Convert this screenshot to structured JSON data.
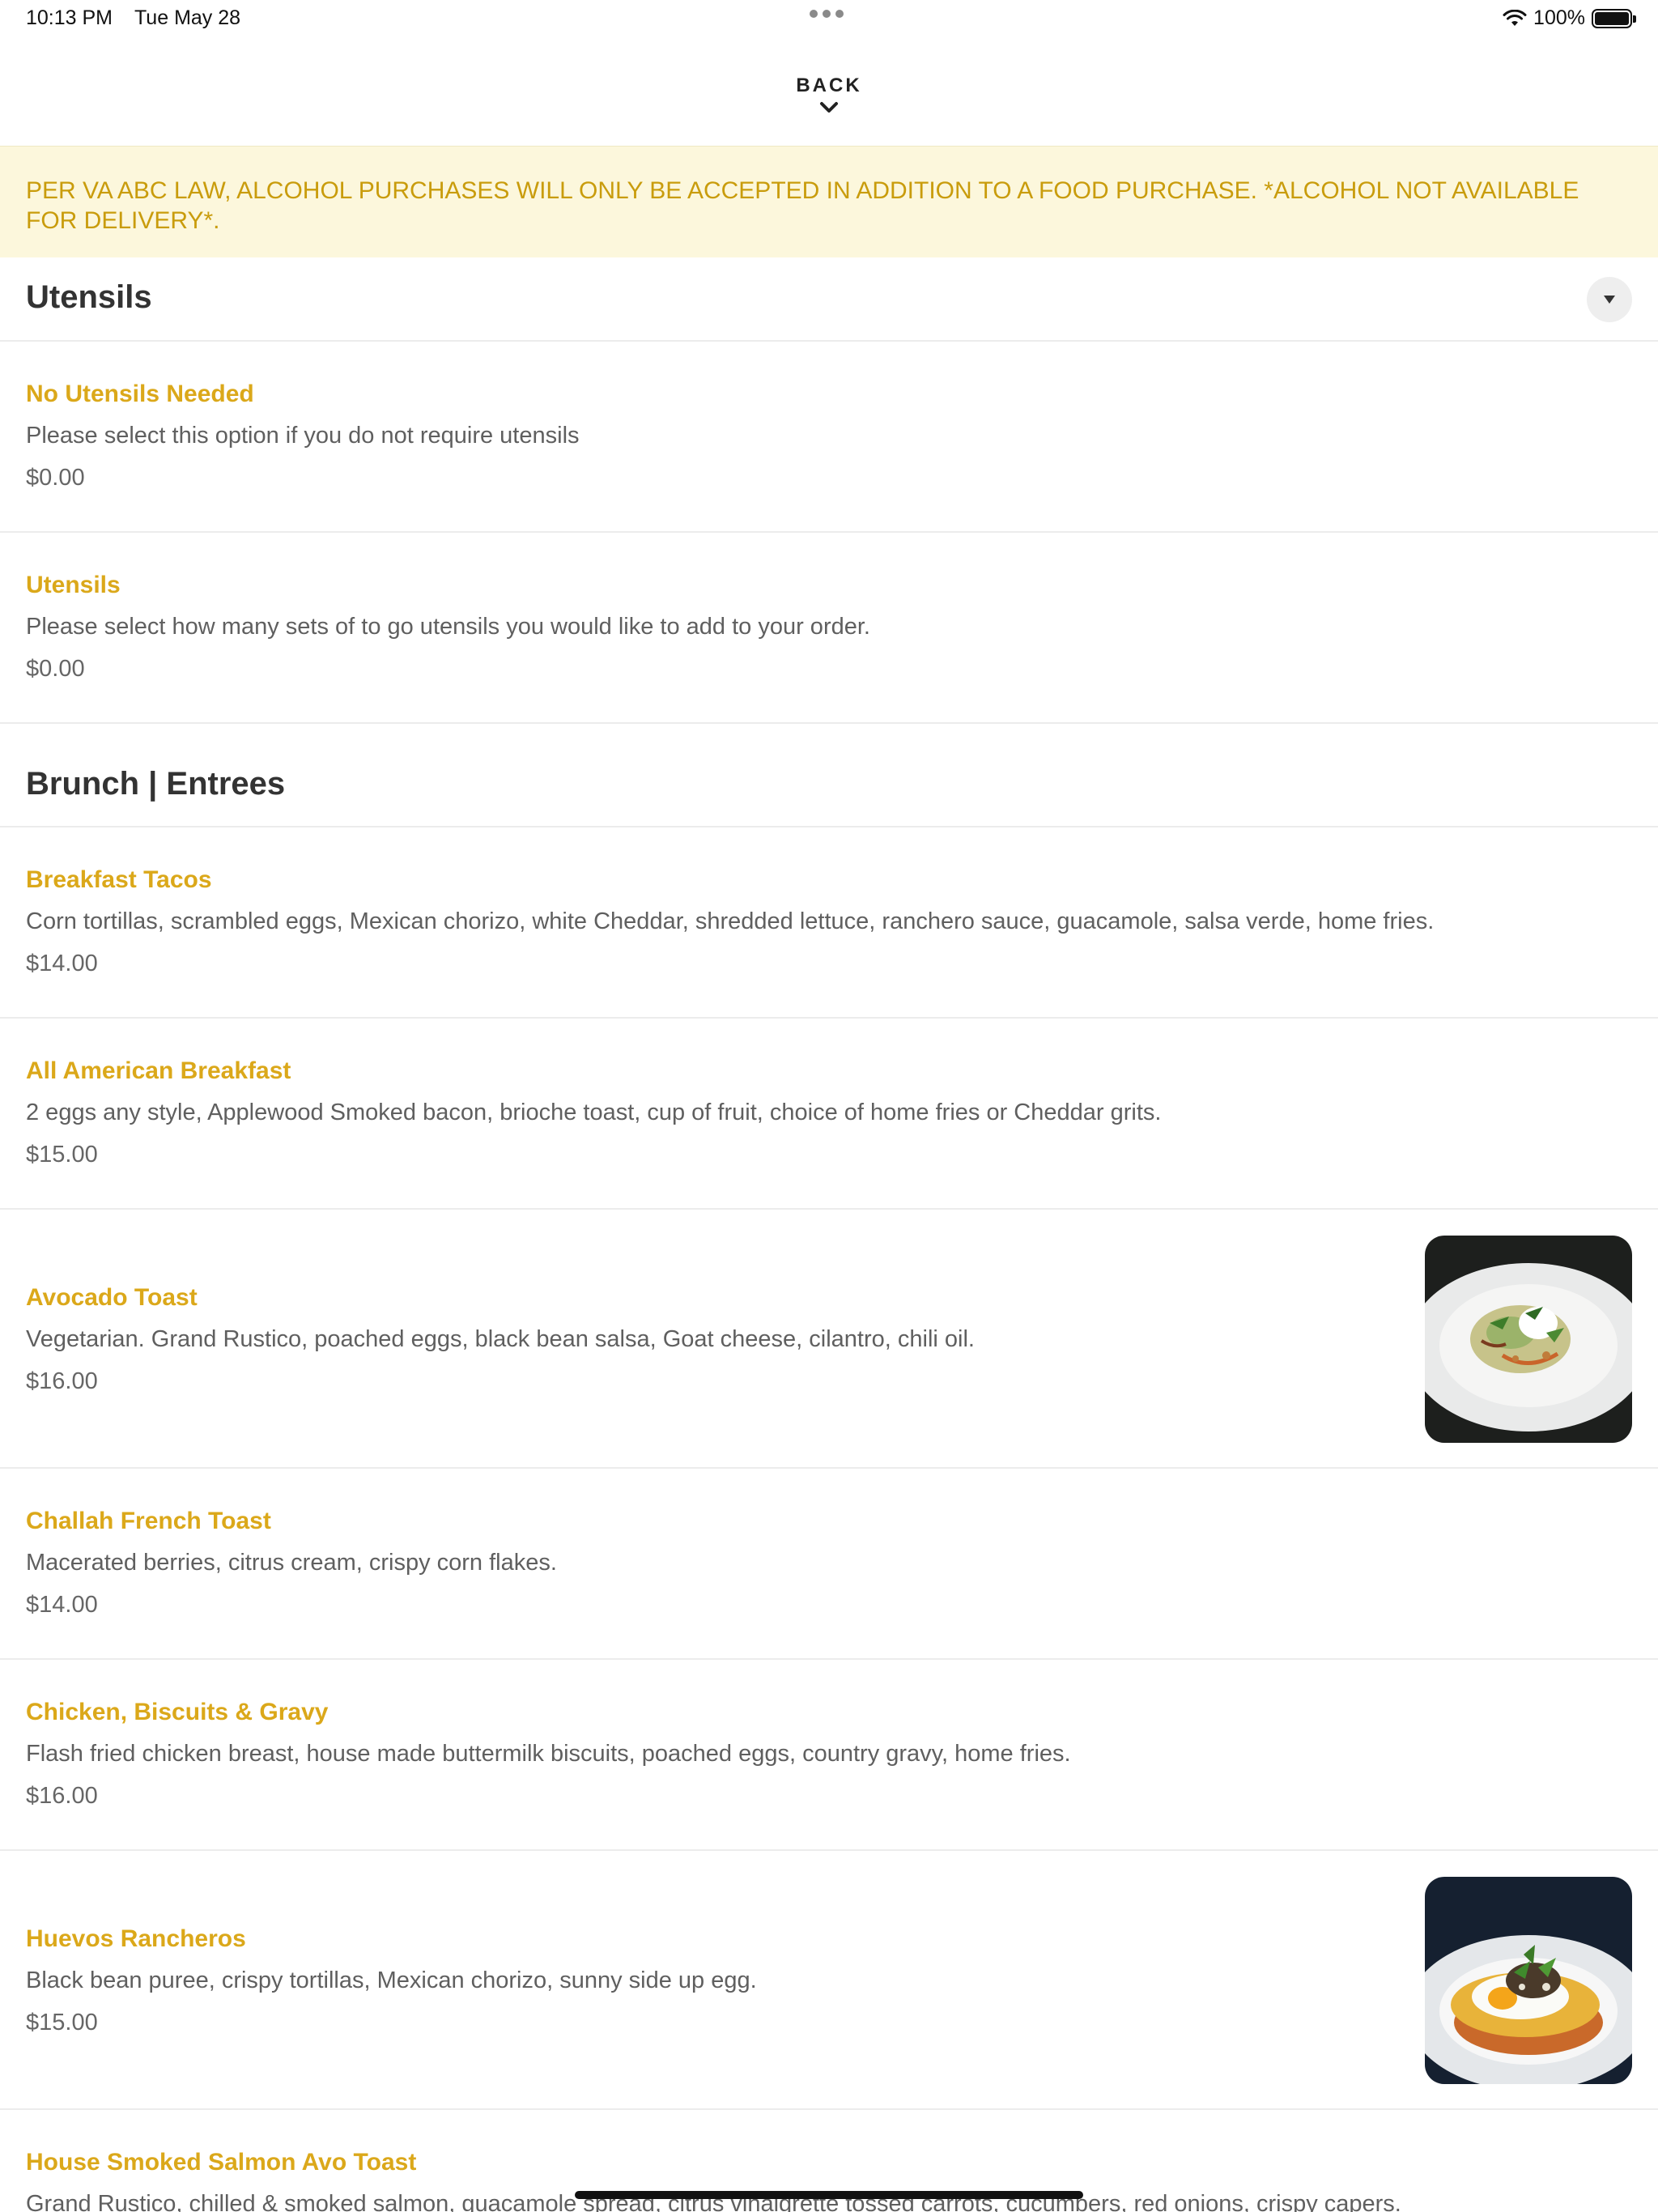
{
  "status_bar": {
    "time": "10:13 PM",
    "date": "Tue May 28",
    "battery": "100%",
    "battery_level": 1.0
  },
  "nav": {
    "back_label": "BACK"
  },
  "notice": {
    "text": "PER VA ABC LAW, ALCOHOL PURCHASES WILL ONLY BE ACCEPTED IN ADDITION TO A FOOD PURCHASE. *ALCOHOL NOT AVAILABLE FOR DELIVERY*."
  },
  "sections": [
    {
      "title": "Utensils",
      "items": [
        {
          "name": "No Utensils Needed",
          "description": "Please select this option if you do not require utensils",
          "price": "$0.00"
        },
        {
          "name": "Utensils",
          "description": "Please select how many sets of to go utensils you would like to add to your order.",
          "price": "$0.00"
        }
      ]
    },
    {
      "title": "Brunch | Entrees",
      "items": [
        {
          "name": "Breakfast Tacos",
          "description": "Corn tortillas, scrambled eggs, Mexican chorizo, white Cheddar, shredded lettuce, ranchero sauce, guacamole, salsa verde, home fries.",
          "price": "$14.00"
        },
        {
          "name": "All American Breakfast",
          "description": "2 eggs any style, Applewood Smoked bacon, brioche toast, cup of fruit, choice of home fries or Cheddar grits.",
          "price": "$15.00"
        },
        {
          "name": "Avocado Toast",
          "description": "Vegetarian. Grand Rustico, poached eggs, black bean salsa, Goat cheese, cilantro, chili oil.",
          "price": "$16.00"
        },
        {
          "name": "Challah French Toast",
          "description": "Macerated berries, citrus cream, crispy corn flakes.",
          "price": "$14.00"
        },
        {
          "name": "Chicken, Biscuits & Gravy",
          "description": "Flash fried chicken breast, house made buttermilk biscuits, poached eggs, country gravy, home fries.",
          "price": "$16.00"
        },
        {
          "name": "Huevos Rancheros",
          "description": "Black bean puree, crispy tortillas, Mexican chorizo, sunny side up egg.",
          "price": "$15.00"
        },
        {
          "name": "House Smoked Salmon Avo Toast",
          "description": "Grand Rustico, chilled & smoked salmon, guacamole spread, citrus vinaigrette tossed carrots, cucumbers, red onions, crispy capers."
        }
      ]
    }
  ],
  "colors": {
    "accent_gold": "#dba81a",
    "notice_bg": "#fcf7dc",
    "notice_text": "#c99c0c"
  }
}
